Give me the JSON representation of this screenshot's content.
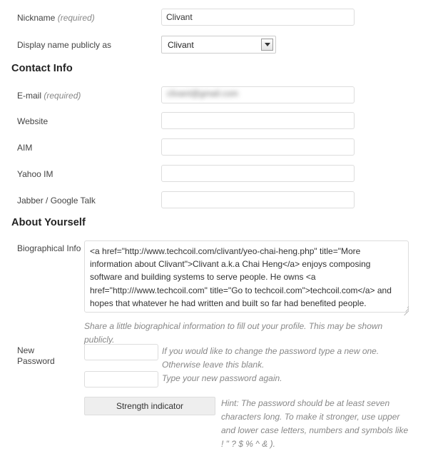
{
  "profile": {
    "nickname": {
      "label": "Nickname",
      "required_note": "(required)",
      "value": "Clivant"
    },
    "display_name": {
      "label": "Display name publicly as",
      "value": "Clivant",
      "dropdown_icon": "chevron-down-icon"
    }
  },
  "contact_info": {
    "heading": "Contact Info",
    "fields": [
      {
        "label": "E-mail",
        "required_note": "(required)",
        "value": "clivant@gmail.com",
        "redacted": true,
        "placeholder": ""
      },
      {
        "label": "Website",
        "required_note": "",
        "value": "",
        "redacted": false,
        "placeholder": ""
      },
      {
        "label": "AIM",
        "required_note": "",
        "value": "",
        "redacted": false,
        "placeholder": ""
      },
      {
        "label": "Yahoo IM",
        "required_note": "",
        "value": "",
        "redacted": false,
        "placeholder": ""
      },
      {
        "label": "Jabber / Google Talk",
        "required_note": "",
        "value": "",
        "redacted": false,
        "placeholder": ""
      }
    ]
  },
  "about_yourself": {
    "heading": "About Yourself",
    "bio": {
      "label": "Biographical Info",
      "value": "<a href=\"http://www.techcoil.com/clivant/yeo-chai-heng.php\" title=\"More information about Clivant\">Clivant a.k.a Chai Heng</a> enjoys composing software and building systems to serve people. He owns <a href=\"http:///www.techcoil.com\" title=\"Go to techcoil.com\">techcoil.com</a> and hopes that whatever he had written and built so far had benefited people.",
      "description": "Share a little biographical information to fill out your profile. This may be shown publicly."
    },
    "password": {
      "label": "New Password",
      "new_password_value": "",
      "new_password_description": "If you would like to change the password type a new one. Otherwise leave this blank.",
      "confirm_password_value": "",
      "confirm_password_description": "Type your new password again.",
      "strength_indicator_label": "Strength indicator",
      "hint": "Hint: The password should be at least seven characters long. To make it stronger, use upper and lower case letters, numbers and symbols like ! \" ? $ % ^ & )."
    }
  },
  "colors": {
    "text": "#333333",
    "muted": "#888888",
    "border": "#dddddd",
    "button_bg": "#eeeeee"
  }
}
